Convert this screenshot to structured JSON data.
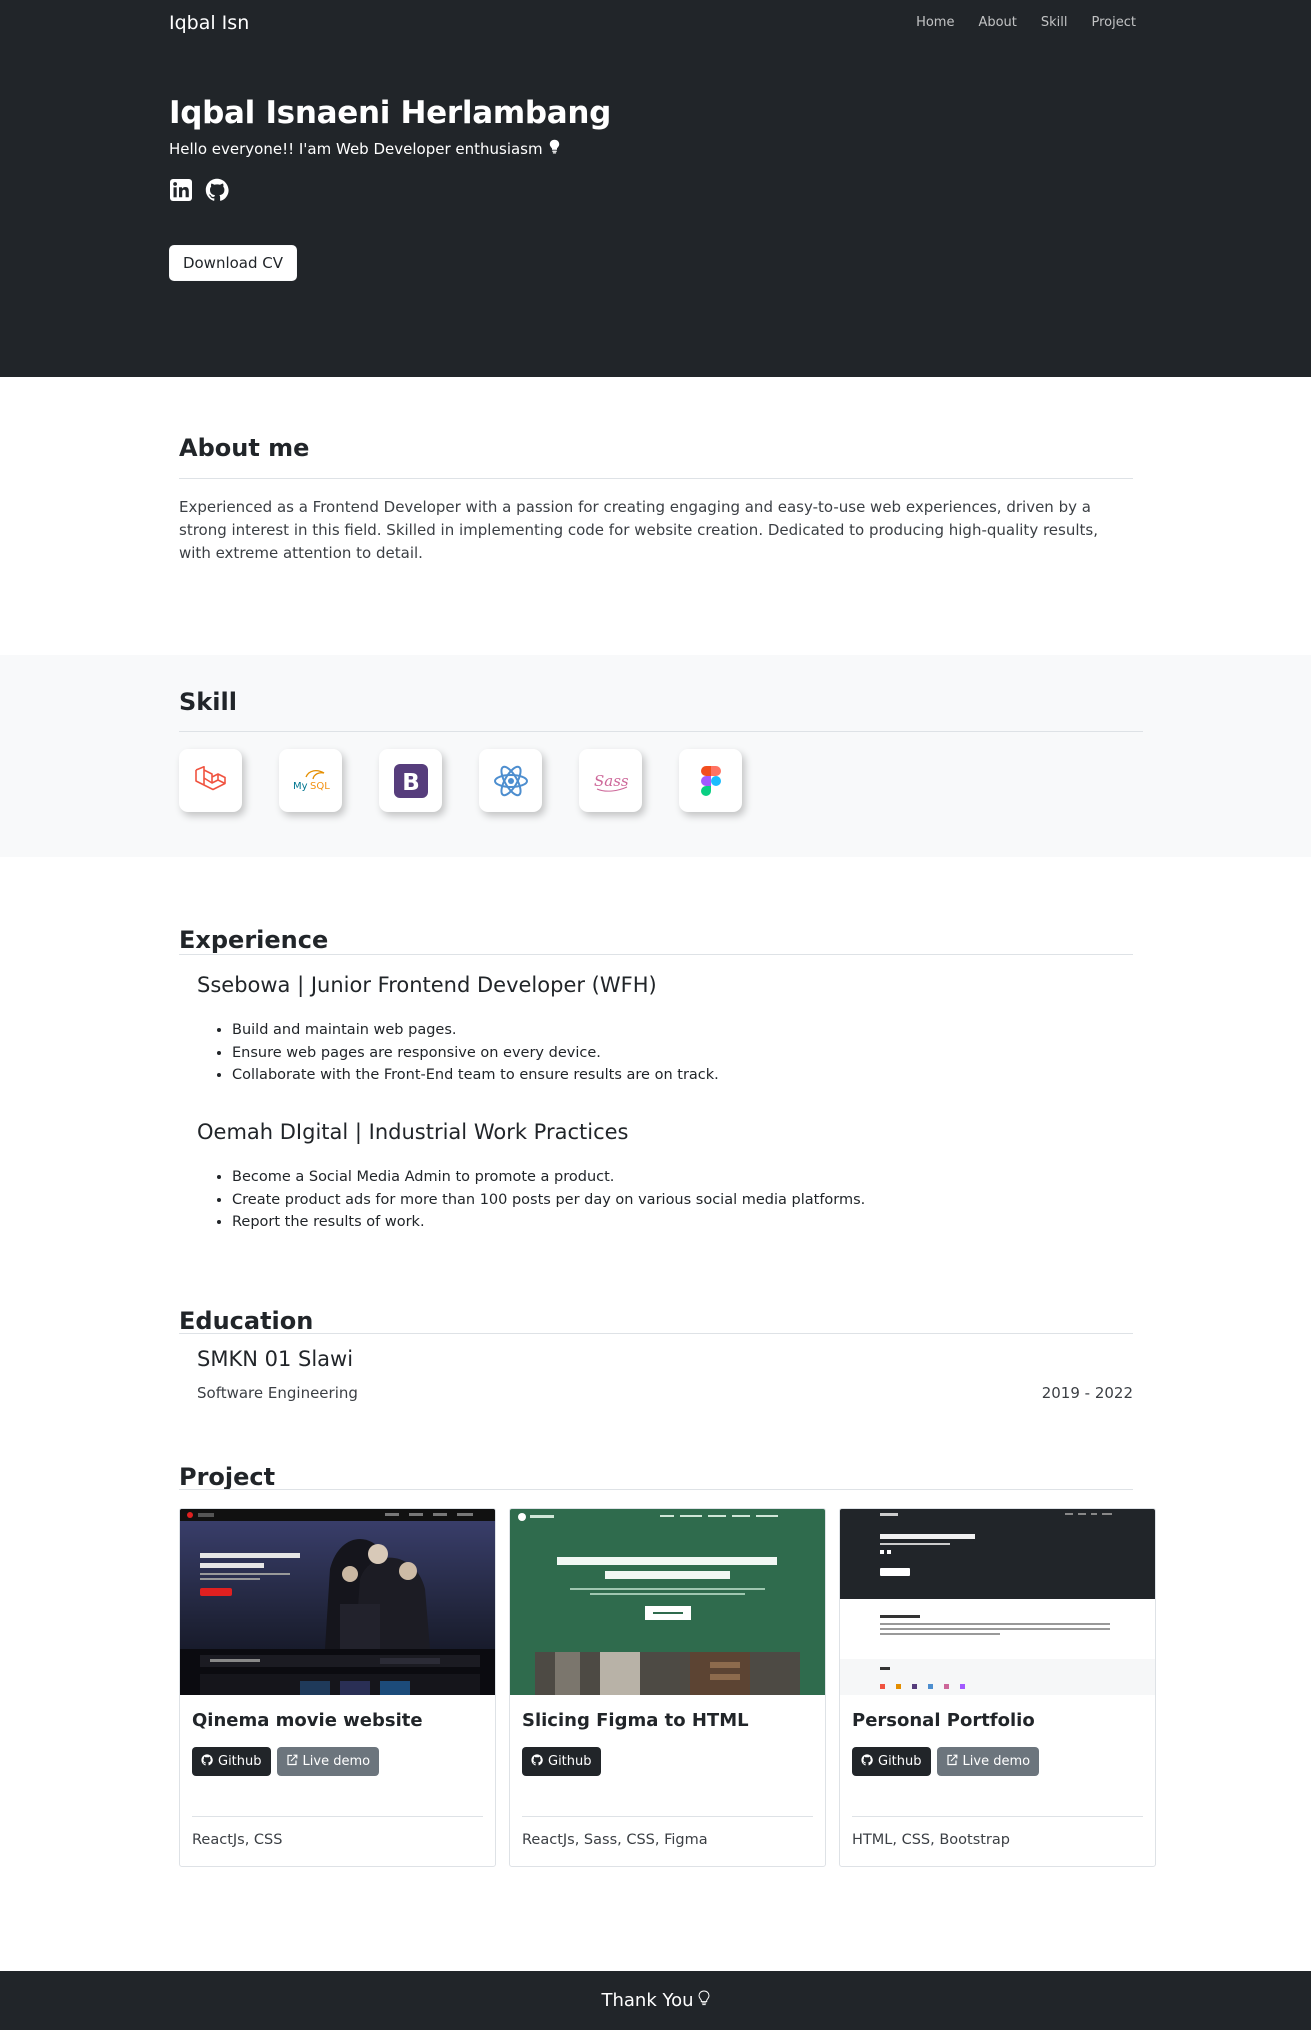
{
  "nav": {
    "brand": "Iqbal Isn",
    "links": [
      "Home",
      "About",
      "Skill",
      "Project"
    ]
  },
  "hero": {
    "name": "Iqbal Isnaeni Herlambang",
    "tagline": "Hello everyone!! I'am Web Developer enthusiasm",
    "cv_button": "Download CV",
    "social_icons": [
      "linkedin-icon",
      "github-icon"
    ]
  },
  "about": {
    "title": "About me",
    "text": "Experienced as a Frontend Developer with a passion for creating engaging and easy-to-use web experiences, driven by a strong interest in this field. Skilled in implementing code for website creation. Dedicated to producing high-quality results, with extreme attention to detail."
  },
  "skill": {
    "title": "Skill",
    "icons": [
      "laravel-icon",
      "mysql-icon",
      "bootstrap-icon",
      "react-icon",
      "sass-icon",
      "figma-icon"
    ]
  },
  "experience": {
    "title": "Experience",
    "jobs": [
      {
        "title": "Ssebowa | Junior Frontend Developer (WFH)",
        "points": [
          "Build and maintain web pages.",
          "Ensure web pages are responsive on every device.",
          "Collaborate with the Front-End team to ensure results are on track."
        ]
      },
      {
        "title": "Oemah DIgital | Industrial Work Practices",
        "points": [
          "Become a Social Media Admin to promote a product.",
          "Create product ads for more than 100 posts per day on various social media platforms.",
          "Report the results of work."
        ]
      }
    ]
  },
  "education": {
    "title": "Education",
    "school": "SMKN 01 Slawi",
    "major": "Software Engineering",
    "period": "2019 - 2022"
  },
  "project": {
    "title": "Project",
    "cards": [
      {
        "title": "Qinema movie website",
        "github": "Github",
        "demo": "Live demo",
        "tech": "ReactJs, CSS"
      },
      {
        "title": "Slicing Figma to HTML",
        "github": "Github",
        "tech": "ReactJs, Sass, CSS, Figma"
      },
      {
        "title": "Personal Portfolio",
        "github": "Github",
        "demo": "Live demo",
        "tech": "HTML, CSS, Bootstrap"
      }
    ]
  },
  "footer": {
    "text": "Thank You"
  }
}
